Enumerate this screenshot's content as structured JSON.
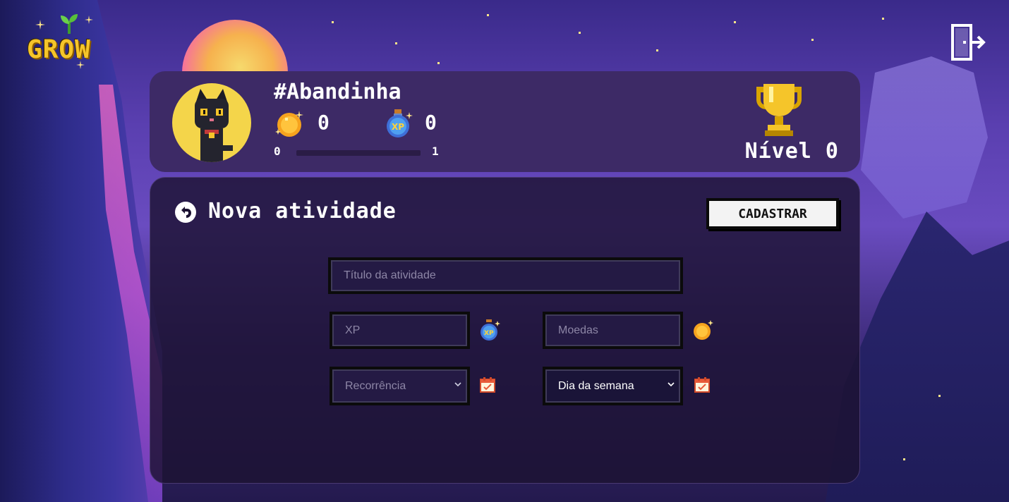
{
  "app": {
    "logo_text": "GROW"
  },
  "profile": {
    "username": "#Abandinha",
    "coins": "0",
    "xp": "0",
    "xp_bar": {
      "min": "0",
      "max": "1",
      "progress": 0
    },
    "level_text": "Nível 0"
  },
  "activity_form": {
    "title": "Nova atividade",
    "submit_label": "CADASTRAR",
    "title_placeholder": "Título da atividade",
    "xp_placeholder": "XP",
    "coins_placeholder": "Moedas",
    "recurrence_selected": "Recorrência",
    "weekday_selected": "Dia da semana"
  },
  "icons": {
    "logo": "grow-logo-icon",
    "logout": "logout-icon",
    "coin": "coin-icon",
    "xp_potion": "xp-potion-icon",
    "trophy": "trophy-icon",
    "back": "back-arrow-icon",
    "calendar": "calendar-icon"
  },
  "colors": {
    "profile_bg": "#3d2a66",
    "panel_bg": "#1c1232",
    "accent_gold": "#f5c52a",
    "avatar_bg": "#f4d54a"
  }
}
